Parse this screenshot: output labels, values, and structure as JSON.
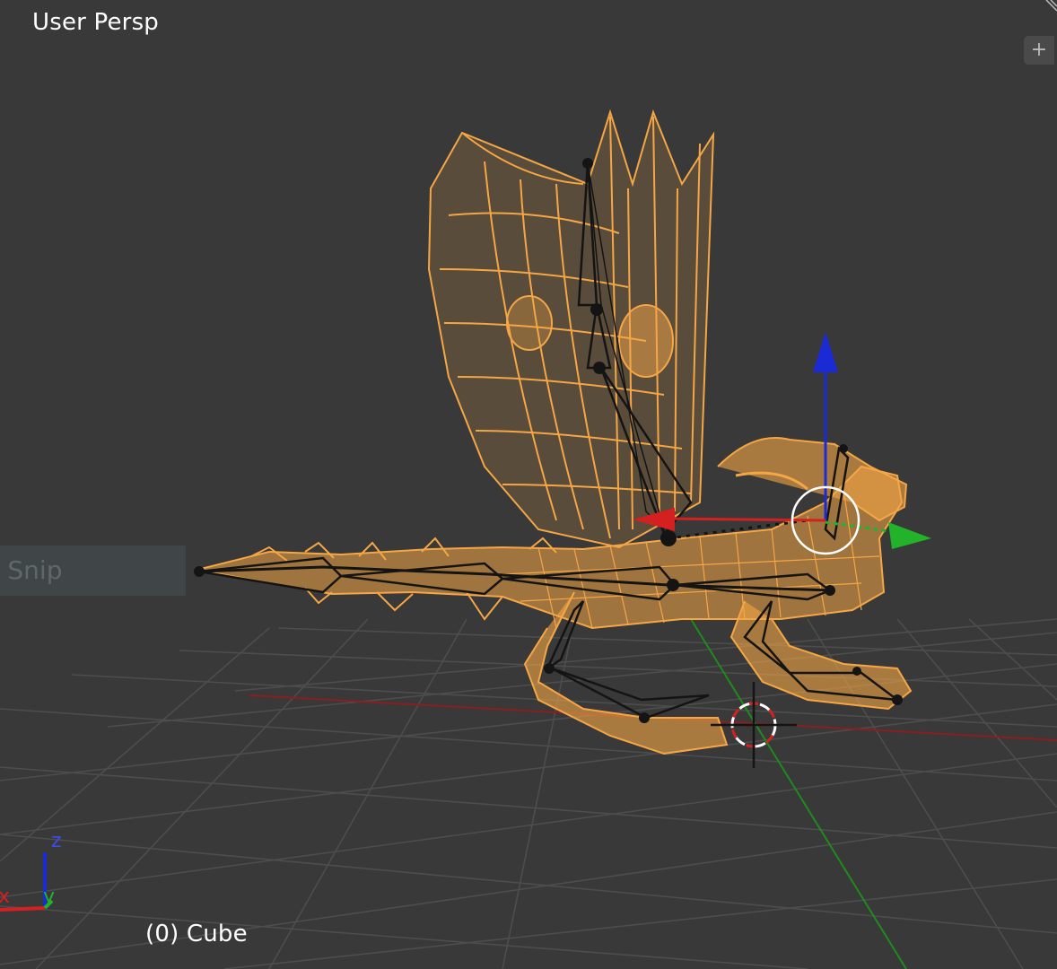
{
  "viewport": {
    "view_label": "User Persp",
    "object_label": "(0) Cube",
    "add_region_icon": "plus-icon",
    "overlay_snippet": "r Snip"
  },
  "axes_gizmo": {
    "x_label": "x",
    "y_label": "y",
    "z_label": "z"
  },
  "colors": {
    "background": "#393939",
    "grid": "#4c4c4c",
    "mesh_wire": "#f5a645",
    "armature": "#141414",
    "x_axis": "#d42020",
    "y_axis": "#22b32b",
    "z_axis": "#1a2bd6",
    "text": "#ffffff"
  }
}
